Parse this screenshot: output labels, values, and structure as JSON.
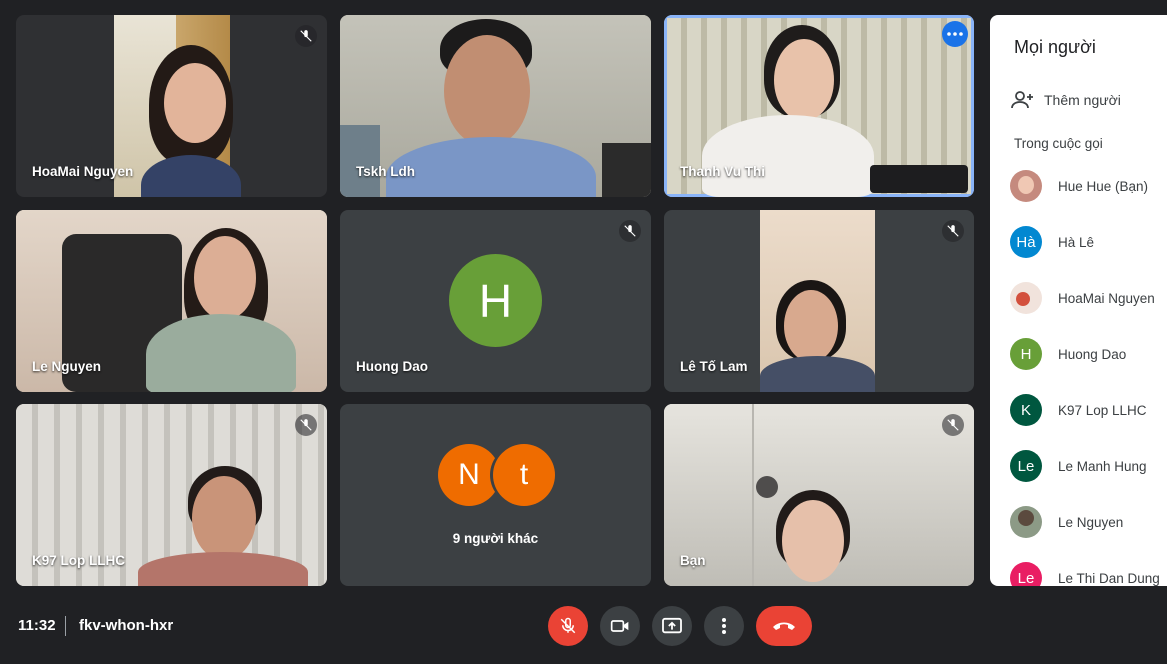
{
  "tiles": [
    {
      "name": "HoaMai Nguyen"
    },
    {
      "name": "Tskh Ldh"
    },
    {
      "name": "Thanh Vu Thi"
    },
    {
      "name": "Le Nguyen"
    },
    {
      "name": "Huong Dao",
      "initial": "H"
    },
    {
      "name": "Lê Tố Lam"
    },
    {
      "name": "K97 Lop LLHC"
    },
    {
      "others_label": "9 người khác",
      "initials": [
        "N",
        "t"
      ]
    },
    {
      "name": "Bạn"
    }
  ],
  "panel": {
    "title": "Mọi người",
    "add_label": "Thêm người",
    "section_label": "Trong cuộc gọi",
    "participants": [
      {
        "name": "Hue Hue (Bạn)",
        "initial": ""
      },
      {
        "name": "Hà Lê",
        "initial": "Hà"
      },
      {
        "name": "HoaMai Nguyen",
        "initial": ""
      },
      {
        "name": "Huong Dao",
        "initial": "H"
      },
      {
        "name": "K97 Lop LLHC",
        "initial": "K"
      },
      {
        "name": "Le Manh Hung",
        "initial": "Le"
      },
      {
        "name": "Le Nguyen",
        "initial": ""
      },
      {
        "name": "Le Thi Dan Dung",
        "initial": "Le"
      }
    ]
  },
  "bottom": {
    "time": "11:32",
    "meeting_code": "fkv-whon-hxr"
  },
  "colors": {
    "accent_blue": "#1a73e8",
    "active_border": "#8ab4f8",
    "mic_off_red": "#ea4335",
    "avatar_green": "#689f38",
    "avatar_orange": "#ef6c00",
    "avatar_teal": "#0288d1",
    "avatar_darkgreen": "#00573f",
    "avatar_pink": "#e91e63"
  },
  "icons": [
    "mic-off-icon",
    "more-options-icon",
    "add-person-icon",
    "camera-icon",
    "present-icon",
    "more-vert-icon",
    "end-call-icon"
  ]
}
